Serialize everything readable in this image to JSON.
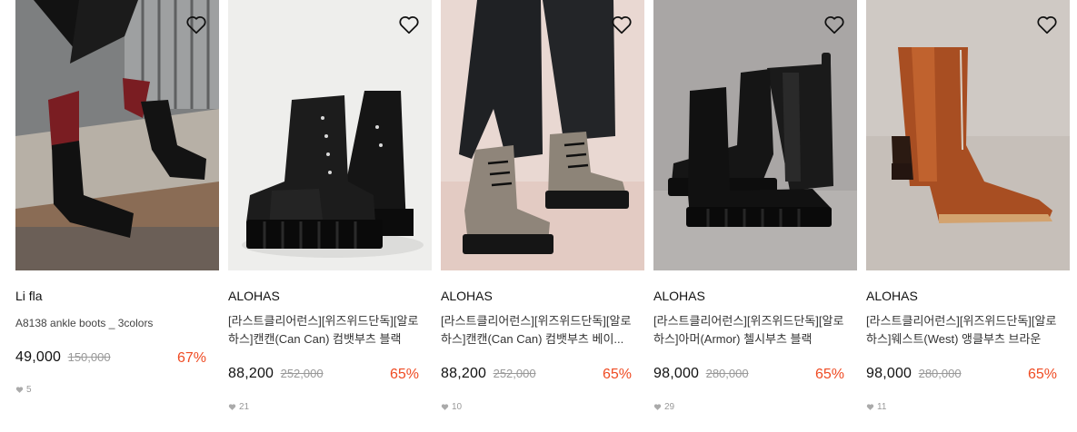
{
  "products": [
    {
      "brand": "Li fla",
      "title": "A8138 ankle boots _ 3colors",
      "price": "49,000",
      "original": "150,000",
      "discount": "67%",
      "likes": "5"
    },
    {
      "brand": "ALOHAS",
      "title": "[라스트클리어런스][위즈위드단독][알로하스]캔캔(Can Can) 컴뱃부츠 블랙",
      "price": "88,200",
      "original": "252,000",
      "discount": "65%",
      "likes": "21"
    },
    {
      "brand": "ALOHAS",
      "title": "[라스트클리어런스][위즈위드단독][알로하스]캔캔(Can Can) 컴뱃부츠 베이...",
      "price": "88,200",
      "original": "252,000",
      "discount": "65%",
      "likes": "10"
    },
    {
      "brand": "ALOHAS",
      "title": "[라스트클리어런스][위즈위드단독][알로하스]아머(Armor) 첼시부츠 블랙",
      "price": "98,000",
      "original": "280,000",
      "discount": "65%",
      "likes": "29"
    },
    {
      "brand": "ALOHAS",
      "title": "[라스트클리어런스][위즈위드단독][알로하스]웨스트(West) 앵클부츠 브라운",
      "price": "98,000",
      "original": "280,000",
      "discount": "65%",
      "likes": "11"
    }
  ],
  "colors": {
    "discount": "#ef4b23",
    "strike": "#999999",
    "brand": "#111111"
  },
  "icons": {
    "wishlist": "heart-outline-icon",
    "likes": "heart-filled-icon"
  }
}
